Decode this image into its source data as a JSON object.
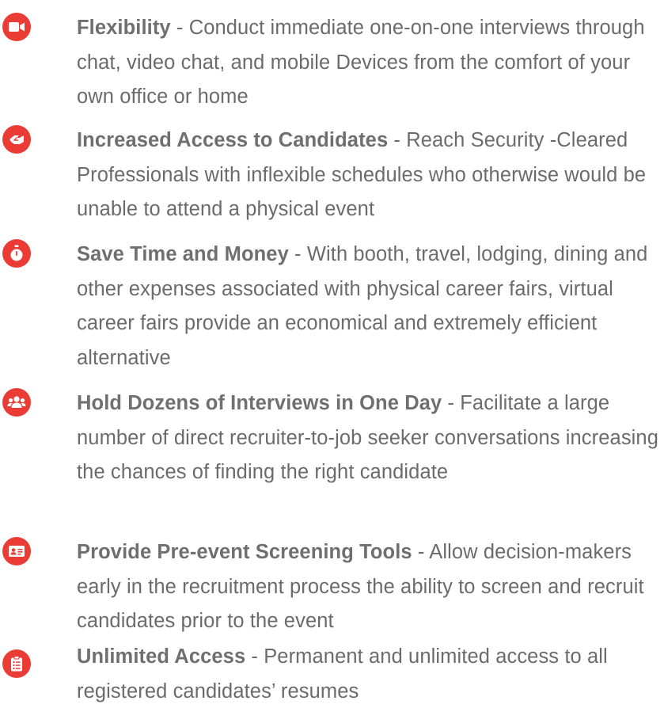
{
  "colors": {
    "accent": "#ea3b35",
    "title": "#6f6f6f",
    "body": "#6b6b6b"
  },
  "features": [
    {
      "icon": "video-camera-icon",
      "title": "Flexibility",
      "separator": " - ",
      "description": "Conduct immediate one-on-one interviews through chat, video chat, and mobile Devices from the comfort of your own office or home"
    },
    {
      "icon": "handshake-icon",
      "title": "Increased Access to Candidates",
      "separator": " - ",
      "description": "Reach Security -Cleared Professionals with inflexible schedules who otherwise would be unable to attend a physical event"
    },
    {
      "icon": "stopwatch-icon",
      "title": "Save Time and Money",
      "separator": " - ",
      "description": "With booth, travel, lodging, dining and other expenses associated with physical career fairs, virtual career fairs provide an economical and extremely efficient alternative"
    },
    {
      "icon": "users-icon",
      "title": "Hold Dozens of Interviews in One Day",
      "separator": " - ",
      "description": "Facilitate a large number of direct recruiter-to-job seeker conversations increasing the chances of finding the right candidate"
    },
    {
      "icon": "id-card-icon",
      "title": "Provide Pre-event Screening Tools",
      "separator": " - ",
      "description": "Allow decision-makers early in the recruitment process the ability to screen and recruit candidates prior to the event"
    },
    {
      "icon": "clipboard-list-icon",
      "title": "Unlimited Access",
      "separator": " - ",
      "description": "Permanent and unlimited access to all registered candidates’ resumes"
    }
  ]
}
